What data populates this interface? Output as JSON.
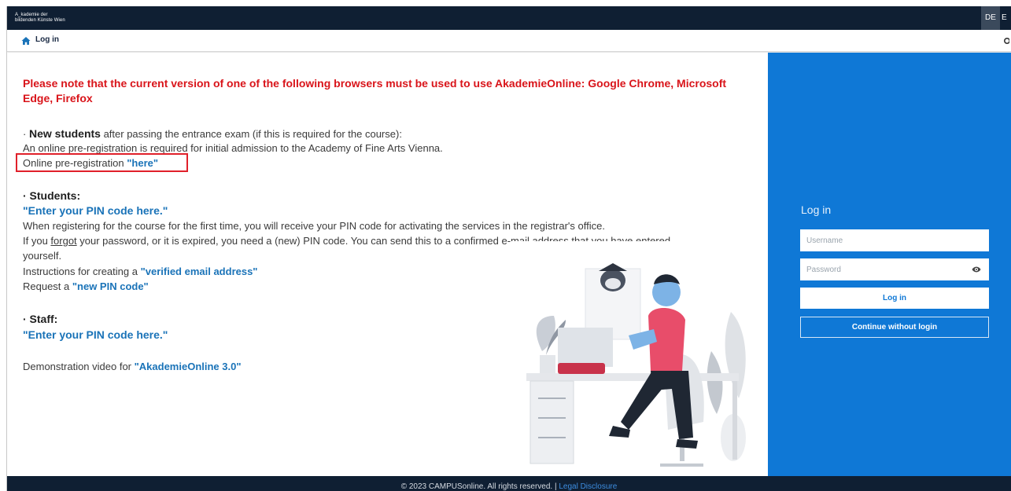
{
  "header": {
    "logo_line1": "A_kademie der",
    "logo_line2": "bildenden Künste Wien",
    "lang_de": "DE",
    "lang_en": "E"
  },
  "navbar": {
    "title": "Log in"
  },
  "content": {
    "notice": "Please note that the current version of one of the following browsers must be used to use AkademieOnline: Google Chrome, Microsoft Edge, Firefox",
    "new_students_bullet": "· ",
    "new_students_label": "New students",
    "new_students_text": " after passing the entrance exam (if this is required for the course):",
    "new_students_line2": "An online pre-registration is required for initial admission to the Academy of Fine Arts Vienna.",
    "prereg_text": "Online pre-registration ",
    "prereg_link": "\"here\"",
    "students_heading": "· Students:",
    "students_pin_link": "\"Enter your PIN code here.\"",
    "students_line1": "When registering for the course for the first time, you will receive your PIN code for activating the services in the registrar's office.",
    "students_line2a": "If you ",
    "students_forgot": "forgot",
    "students_line2b": " your password, or it is expired, you need a (new) PIN code. You can send this to a confirmed e-mail address that you have entered",
    "students_line3": "yourself.",
    "verified_text": "Instructions for creating a ",
    "verified_link": "\"verified email address\"",
    "newpin_text": "Request a ",
    "newpin_link": "\"new PIN code\"",
    "staff_heading": "· Staff:",
    "staff_pin_link": "\"Enter your PIN code here.\"",
    "demo_text": "Demonstration video for ",
    "demo_link": "\"AkademieOnline 3.0\""
  },
  "login": {
    "title": "Log in",
    "username_placeholder": "Username",
    "password_placeholder": "Password",
    "login_button": "Log in",
    "guest_button": "Continue without login"
  },
  "footer": {
    "copyright": "© 2023 CAMPUSonline. All rights reserved. | ",
    "legal": "Legal Disclosure"
  },
  "colors": {
    "topbar": "#0f1f33",
    "panel_blue": "#0f78d6",
    "notice_red": "#d9141a",
    "link_blue": "#1a73b8"
  },
  "icons": [
    "home-icon",
    "gear-icon",
    "eye-icon"
  ]
}
